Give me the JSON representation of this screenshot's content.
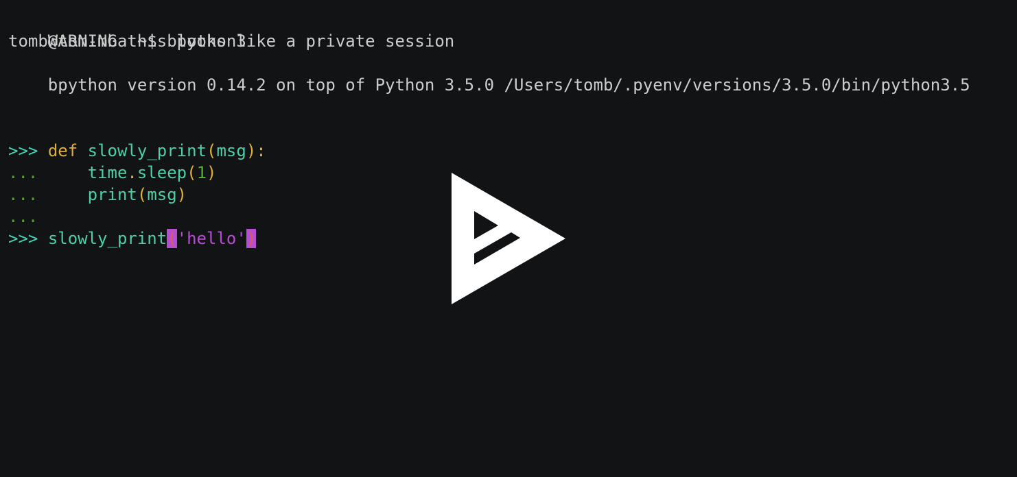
{
  "terminal": {
    "warning": "WARNING this looks like a private session",
    "shell_prompt": "tomb@tom-mba ~$ ",
    "shell_command": "bpython3",
    "version_line": "bpython version 0.14.2 on top of Python 3.5.0 /Users/tomb/.pyenv/versions/3.5.0/bin/python3.5",
    "primary_prompt": ">>>",
    "continuation_prompt": "...",
    "code": {
      "line1": {
        "kw": "def",
        "name": "slowly_print",
        "open": "(",
        "arg": "msg",
        "close": "):"
      },
      "line2": {
        "indent": "    ",
        "obj": "time",
        "dot": ".",
        "fn": "sleep",
        "open": "(",
        "num": "1",
        "close": ")"
      },
      "line3": {
        "indent": "    ",
        "fn": "print",
        "open": "(",
        "arg": "msg",
        "close": ")"
      },
      "line5": {
        "fn": "slowly_print",
        "open": "(",
        "str": "'hello'",
        "close": ")"
      }
    }
  },
  "overlay": {
    "icon": "asciinema-play-icon",
    "color": "#ffffff"
  },
  "colors": {
    "background": "#121314",
    "text": "#cccccc",
    "prompt": "#42d5b2",
    "keyword": "#ddaf3c",
    "identifier": "#4fcfa6",
    "number": "#55b02a",
    "string": "#b54fd1",
    "bracket_highlight": "#b54fd1"
  }
}
